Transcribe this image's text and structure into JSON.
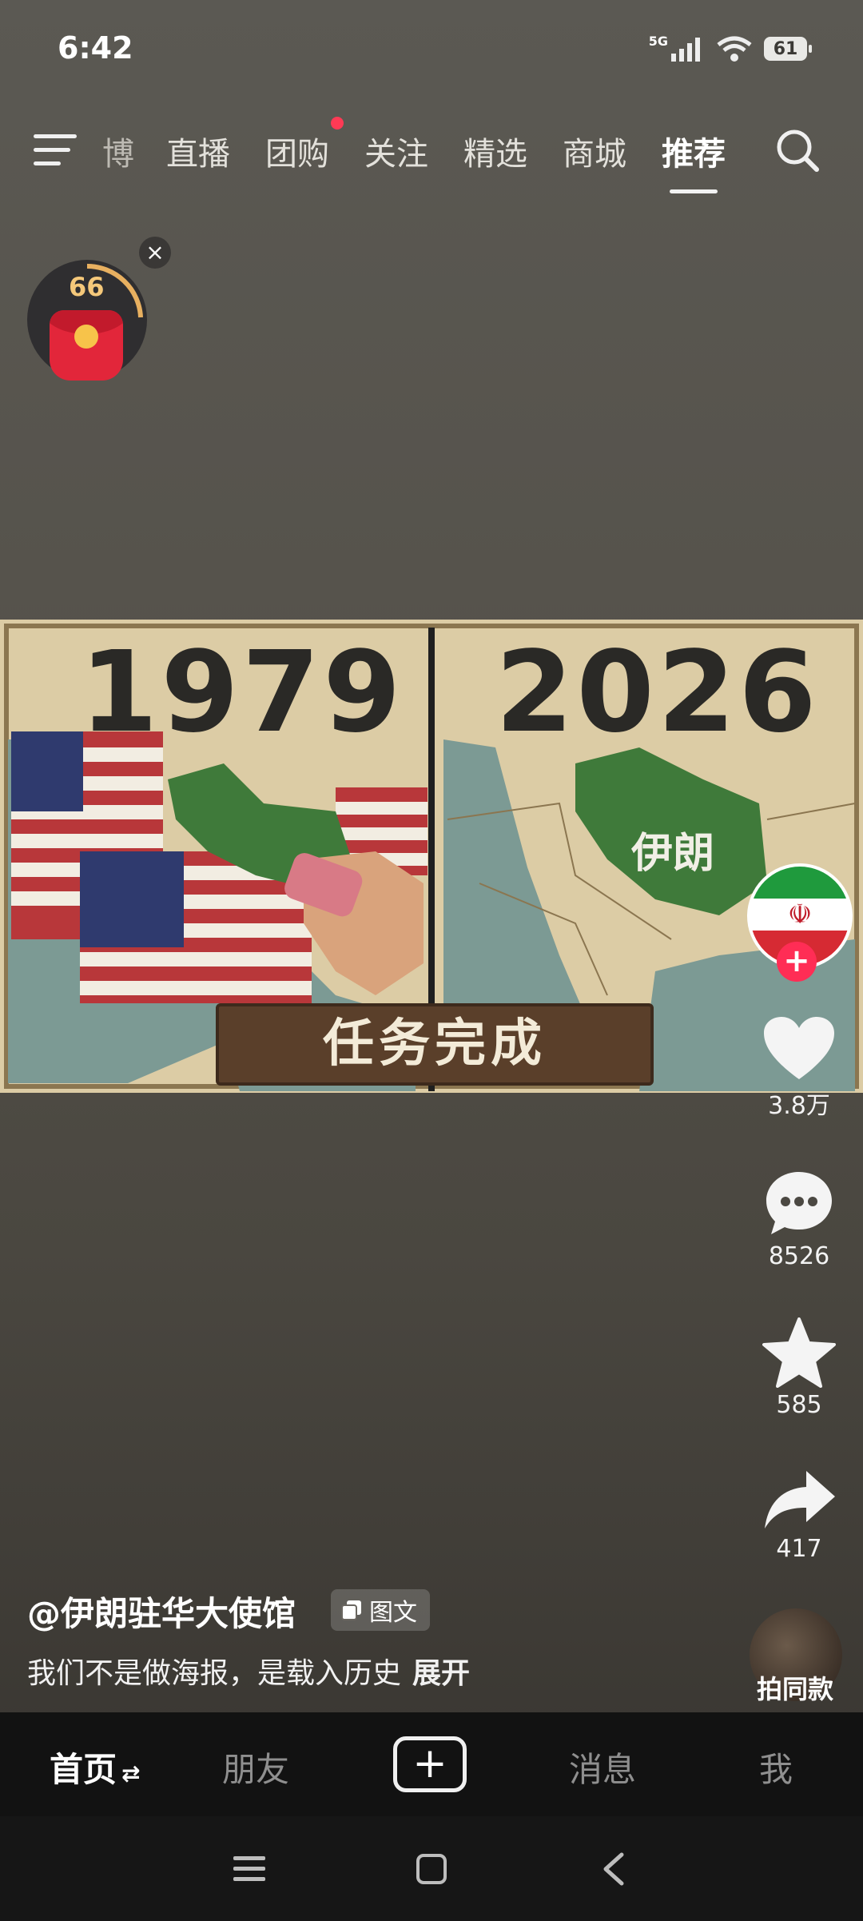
{
  "status": {
    "time": "6:42",
    "network": "5G",
    "battery": "61"
  },
  "topnav": {
    "tabs": [
      "博",
      "直播",
      "团购",
      "关注",
      "精选",
      "商城",
      "推荐"
    ],
    "active": "推荐"
  },
  "widget": {
    "count": "66",
    "close": "×"
  },
  "poster": {
    "year_left": "1979",
    "year_right": "2026",
    "country_label": "伊朗",
    "banner": "任务完成"
  },
  "rail": {
    "likes": "3.8万",
    "comments": "8526",
    "favorites": "585",
    "shares": "417",
    "shoot_same": "拍同款"
  },
  "post": {
    "author": "@伊朗驻华大使馆",
    "badge": "图文",
    "caption": "我们不是做海报，是载入历史",
    "expand": "展开"
  },
  "bottomnav": {
    "home": "首页",
    "friends": "朋友",
    "messages": "消息",
    "me": "我"
  },
  "colors": {
    "accent": "#ff2d55",
    "poster_bg": "#d9c9a1",
    "iran_green": "#3f7a3a"
  }
}
